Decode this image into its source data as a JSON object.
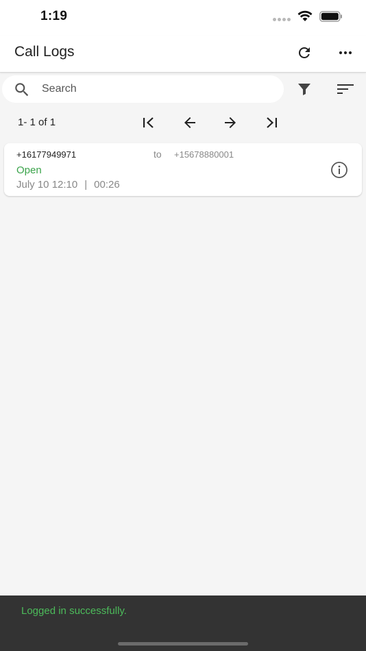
{
  "status_bar": {
    "time": "1:19"
  },
  "app_bar": {
    "title": "Call Logs"
  },
  "search": {
    "placeholder": "Search",
    "value": ""
  },
  "pager": {
    "info": "1- 1 of 1"
  },
  "call_logs": [
    {
      "from": "+16177949971",
      "to_label": "to",
      "to": "+15678880001",
      "status": "Open",
      "date": "July 10 12:10",
      "separator": "|",
      "duration": "00:26"
    }
  ],
  "snackbar": {
    "message": "Logged in successfully."
  },
  "colors": {
    "status_open": "#3aa34a",
    "snackbar_bg": "#333333",
    "snackbar_text": "#4cbb5a",
    "background": "#f5f5f5"
  },
  "icons": [
    "refresh-icon",
    "more-horizontal-icon",
    "search-icon",
    "filter-icon",
    "sort-icon",
    "first-page-icon",
    "arrow-left-icon",
    "arrow-right-icon",
    "last-page-icon",
    "info-icon",
    "wifi-icon",
    "battery-icon"
  ]
}
